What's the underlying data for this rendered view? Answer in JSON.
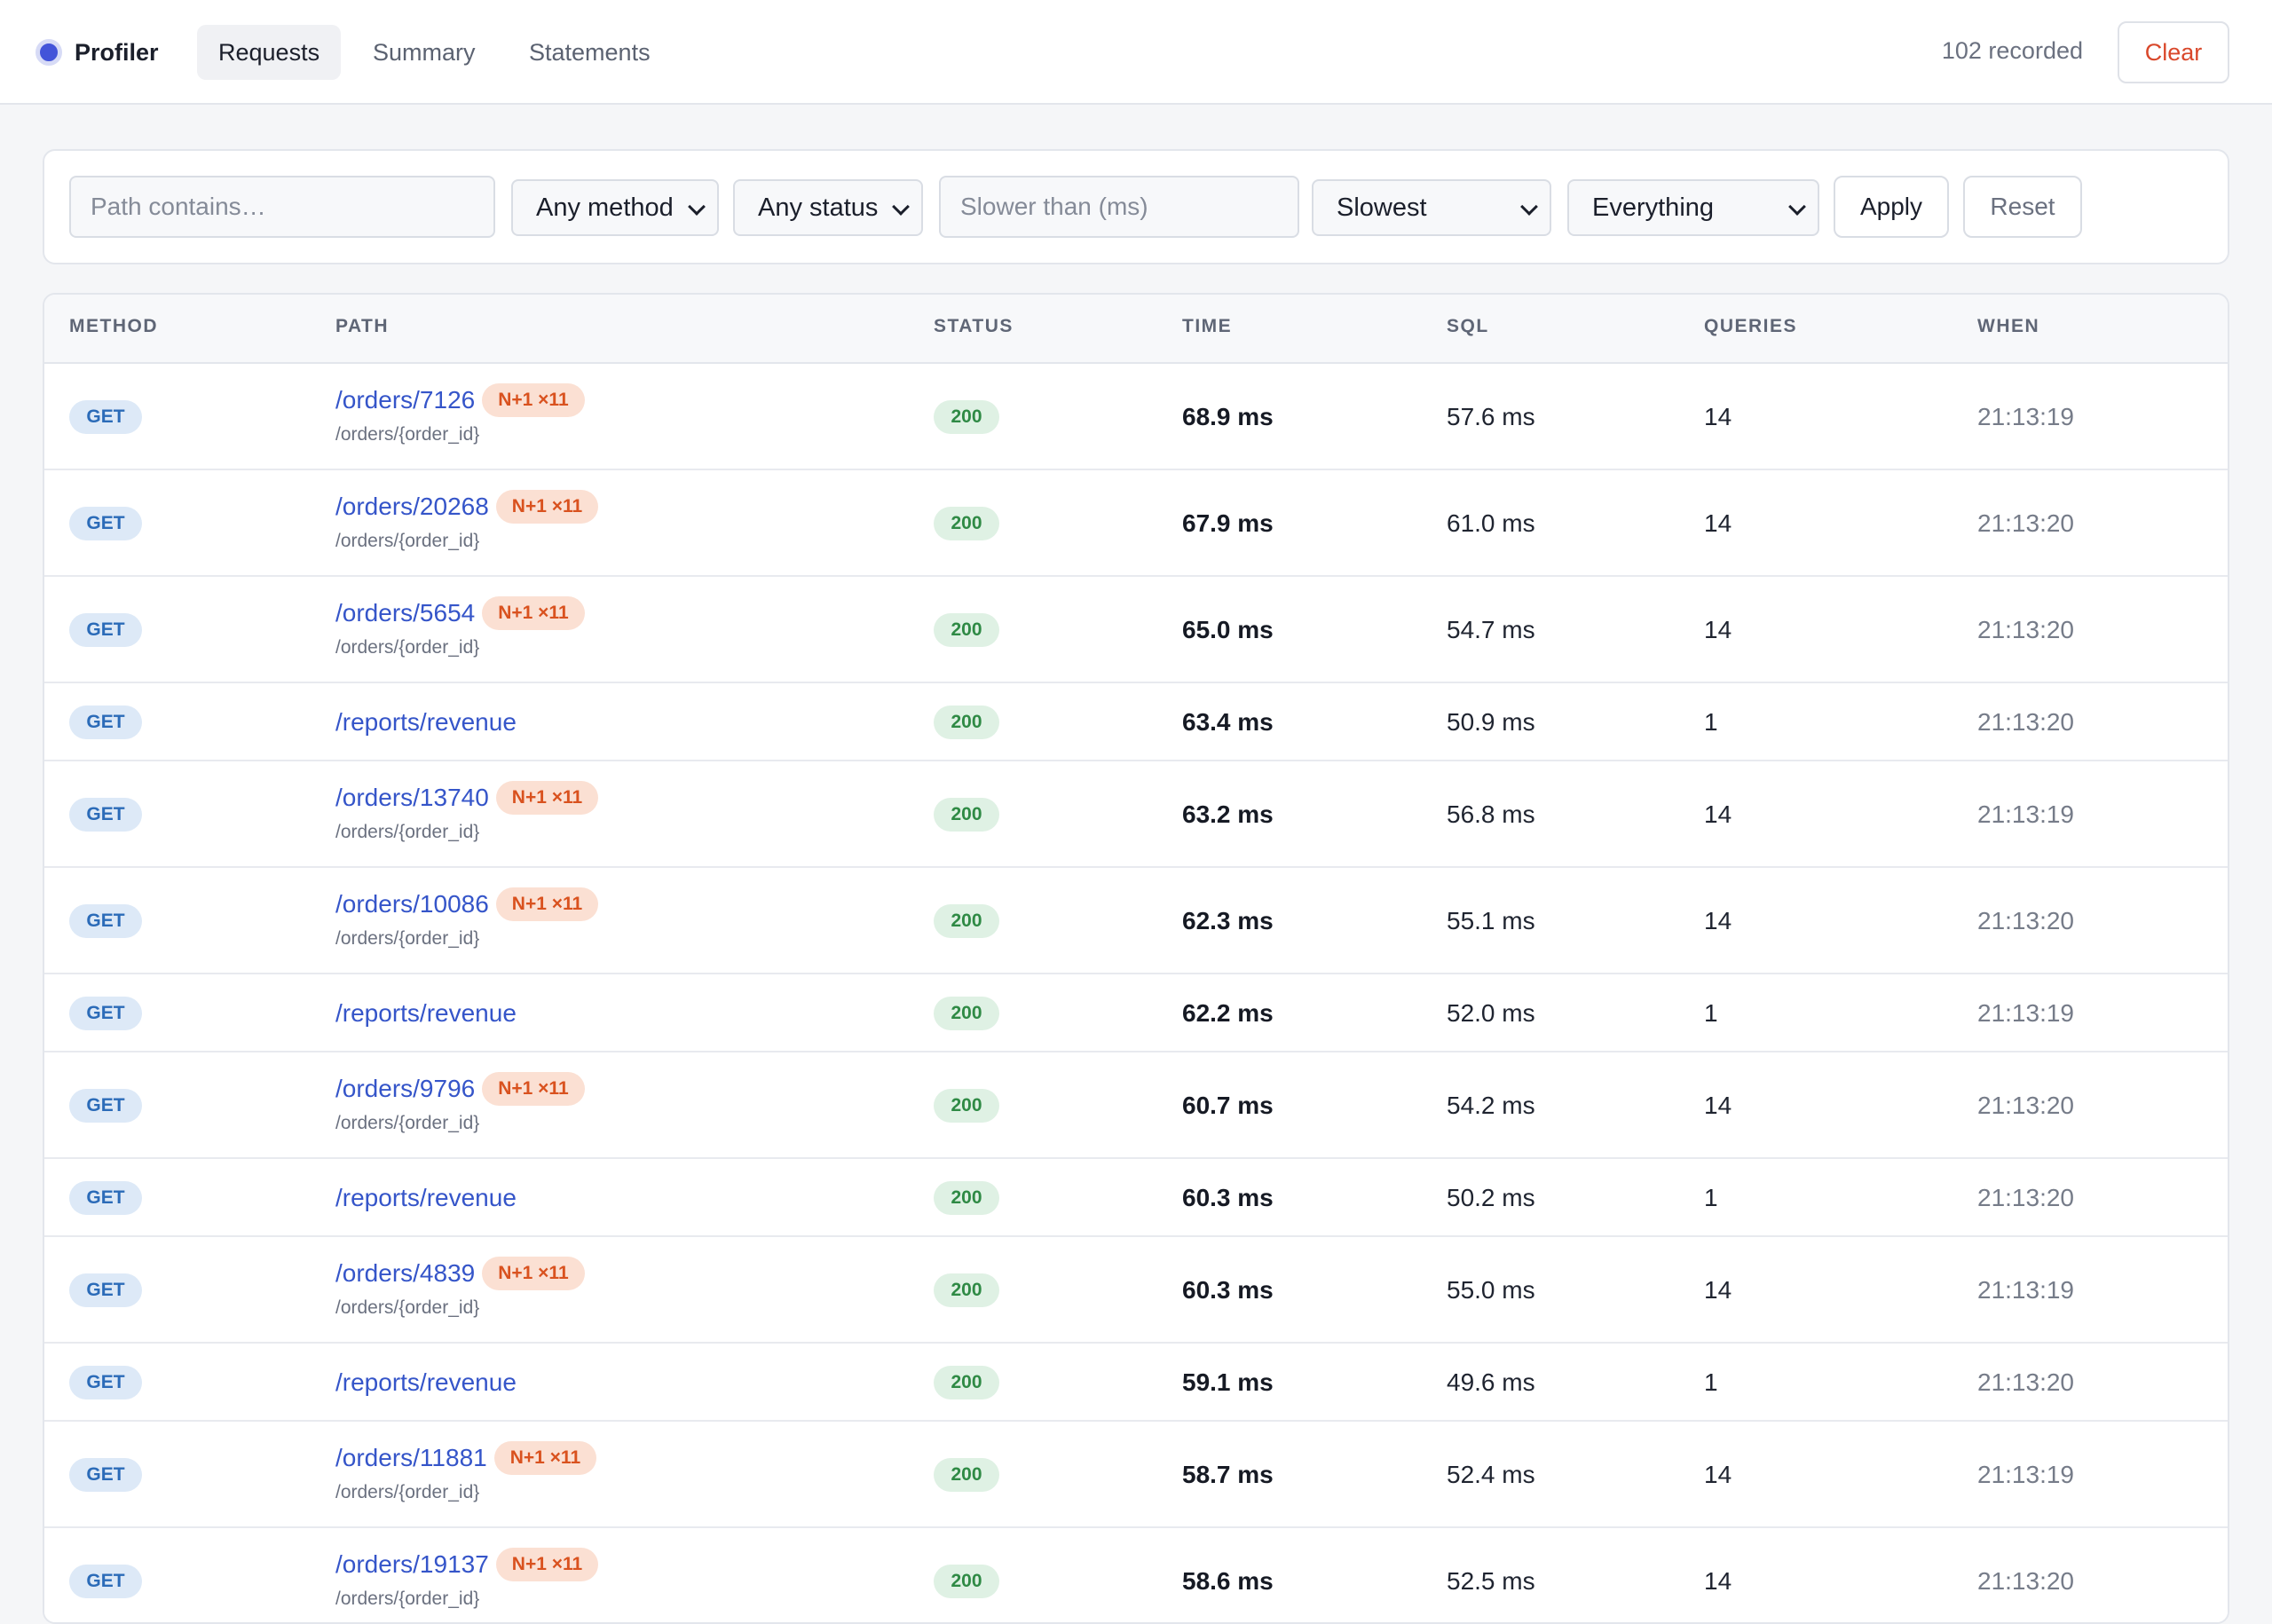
{
  "header": {
    "brand": "Profiler",
    "tabs": [
      "Requests",
      "Summary",
      "Statements"
    ],
    "active_tab": "Requests",
    "recorded": "102 recorded",
    "clear_label": "Clear"
  },
  "filters": {
    "path_placeholder": "Path contains…",
    "method_value": "Any method",
    "status_value": "Any status",
    "slower_placeholder": "Slower than (ms)",
    "sort_value": "Slowest",
    "scope_value": "Everything",
    "apply_label": "Apply",
    "reset_label": "Reset"
  },
  "table": {
    "columns": [
      "METHOD",
      "PATH",
      "STATUS",
      "TIME",
      "SQL",
      "QUERIES",
      "WHEN"
    ],
    "rows": [
      {
        "method": "GET",
        "path": "/orders/7126",
        "badge": "N+1 ×11",
        "template": "/orders/{order_id}",
        "status": "200",
        "time": "68.9 ms",
        "sql": "57.6 ms",
        "queries": "14",
        "when": "21:13:19"
      },
      {
        "method": "GET",
        "path": "/orders/20268",
        "badge": "N+1 ×11",
        "template": "/orders/{order_id}",
        "status": "200",
        "time": "67.9 ms",
        "sql": "61.0 ms",
        "queries": "14",
        "when": "21:13:20"
      },
      {
        "method": "GET",
        "path": "/orders/5654",
        "badge": "N+1 ×11",
        "template": "/orders/{order_id}",
        "status": "200",
        "time": "65.0 ms",
        "sql": "54.7 ms",
        "queries": "14",
        "when": "21:13:20"
      },
      {
        "method": "GET",
        "path": "/reports/revenue",
        "badge": "",
        "template": "",
        "status": "200",
        "time": "63.4 ms",
        "sql": "50.9 ms",
        "queries": "1",
        "when": "21:13:20"
      },
      {
        "method": "GET",
        "path": "/orders/13740",
        "badge": "N+1 ×11",
        "template": "/orders/{order_id}",
        "status": "200",
        "time": "63.2 ms",
        "sql": "56.8 ms",
        "queries": "14",
        "when": "21:13:19"
      },
      {
        "method": "GET",
        "path": "/orders/10086",
        "badge": "N+1 ×11",
        "template": "/orders/{order_id}",
        "status": "200",
        "time": "62.3 ms",
        "sql": "55.1 ms",
        "queries": "14",
        "when": "21:13:20"
      },
      {
        "method": "GET",
        "path": "/reports/revenue",
        "badge": "",
        "template": "",
        "status": "200",
        "time": "62.2 ms",
        "sql": "52.0 ms",
        "queries": "1",
        "when": "21:13:19"
      },
      {
        "method": "GET",
        "path": "/orders/9796",
        "badge": "N+1 ×11",
        "template": "/orders/{order_id}",
        "status": "200",
        "time": "60.7 ms",
        "sql": "54.2 ms",
        "queries": "14",
        "when": "21:13:20"
      },
      {
        "method": "GET",
        "path": "/reports/revenue",
        "badge": "",
        "template": "",
        "status": "200",
        "time": "60.3 ms",
        "sql": "50.2 ms",
        "queries": "1",
        "when": "21:13:20"
      },
      {
        "method": "GET",
        "path": "/orders/4839",
        "badge": "N+1 ×11",
        "template": "/orders/{order_id}",
        "status": "200",
        "time": "60.3 ms",
        "sql": "55.0 ms",
        "queries": "14",
        "when": "21:13:19"
      },
      {
        "method": "GET",
        "path": "/reports/revenue",
        "badge": "",
        "template": "",
        "status": "200",
        "time": "59.1 ms",
        "sql": "49.6 ms",
        "queries": "1",
        "when": "21:13:20"
      },
      {
        "method": "GET",
        "path": "/orders/11881",
        "badge": "N+1 ×11",
        "template": "/orders/{order_id}",
        "status": "200",
        "time": "58.7 ms",
        "sql": "52.4 ms",
        "queries": "14",
        "when": "21:13:19"
      },
      {
        "method": "GET",
        "path": "/orders/19137",
        "badge": "N+1 ×11",
        "template": "/orders/{order_id}",
        "status": "200",
        "time": "58.6 ms",
        "sql": "52.5 ms",
        "queries": "14",
        "when": "21:13:20"
      }
    ]
  }
}
